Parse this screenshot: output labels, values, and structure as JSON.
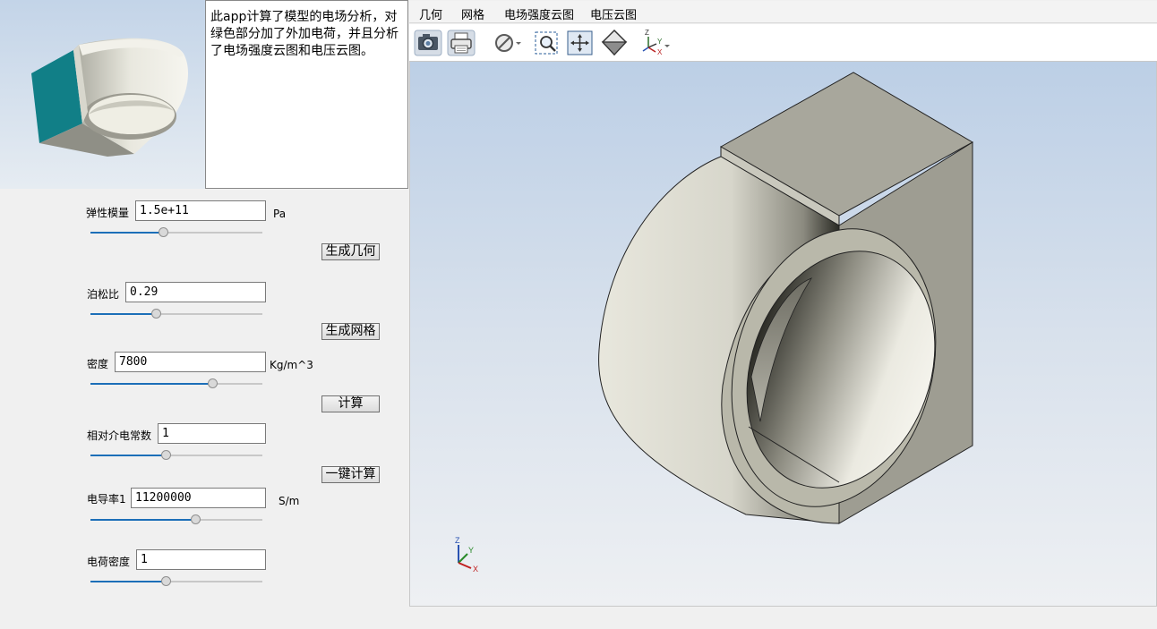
{
  "description": "此app计算了模型的电场分析，对绿色部分加了外加电荷，并且分析了电场强度云图和电压云图。",
  "params": [
    {
      "label": "弹性模量",
      "value": "1.5e+11",
      "unit": "Pa",
      "slider_fraction": 0.42
    },
    {
      "label": "泊松比",
      "value": "0.29",
      "unit": "",
      "slider_fraction": 0.38
    },
    {
      "label": "密度",
      "value": "7800",
      "unit": "Kg/m^3",
      "slider_fraction": 0.71
    },
    {
      "label": "相对介电常数",
      "value": "1",
      "unit": "",
      "slider_fraction": 0.44
    },
    {
      "label": "电导率1",
      "value": "11200000",
      "unit": "S/m",
      "slider_fraction": 0.61
    },
    {
      "label": "电荷密度",
      "value": "1",
      "unit": "",
      "slider_fraction": 0.44
    }
  ],
  "buttons": {
    "generate_geometry": "生成几何",
    "generate_mesh": "生成网格",
    "compute": "计算",
    "one_click_compute": "一键计算"
  },
  "tabs": [
    "几何",
    "网格",
    "电场强度云图",
    "电压云图"
  ],
  "toolbar": [
    "camera-icon",
    "print-icon",
    "hide-icon",
    "zoom-box-icon",
    "fit-view-icon",
    "view-cube-icon",
    "axis-orientation-icon"
  ],
  "triad": {
    "x": "X",
    "y": "Y",
    "z": "Z"
  },
  "colors": {
    "accent": "#1c6fb8",
    "model": "#b9b8aa",
    "teal_face": "#0f7f86"
  }
}
